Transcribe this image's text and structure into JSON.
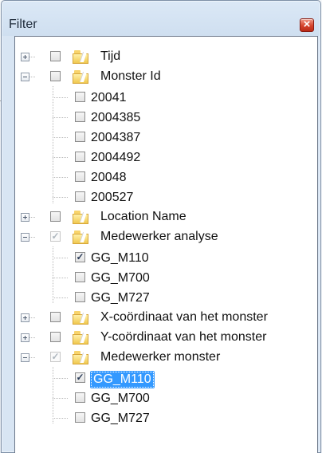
{
  "window": {
    "title": "Filter",
    "close_icon": "close-icon"
  },
  "tree": {
    "nodes": [
      {
        "label": "Tijd",
        "expanded": false,
        "checked": false
      },
      {
        "label": "Monster Id",
        "expanded": true,
        "checked": false,
        "children": [
          {
            "label": "20041",
            "checked": false
          },
          {
            "label": "2004385",
            "checked": false
          },
          {
            "label": "2004387",
            "checked": false
          },
          {
            "label": "2004492",
            "checked": false
          },
          {
            "label": "20048",
            "checked": false
          },
          {
            "label": "200527",
            "checked": false
          }
        ]
      },
      {
        "label": "Location Name",
        "expanded": false,
        "checked": false
      },
      {
        "label": "Medewerker analyse",
        "expanded": true,
        "checked": "partial",
        "children": [
          {
            "label": "GG_M110",
            "checked": true
          },
          {
            "label": "GG_M700",
            "checked": false
          },
          {
            "label": "GG_M727",
            "checked": false
          }
        ]
      },
      {
        "label": "X-coördinaat van het monster",
        "expanded": false,
        "checked": false
      },
      {
        "label": "Y-coördinaat van het monster",
        "expanded": false,
        "checked": false
      },
      {
        "label": "Medewerker monster",
        "expanded": true,
        "checked": "partial",
        "children": [
          {
            "label": "GG_M110",
            "checked": true,
            "selected": true
          },
          {
            "label": "GG_M700",
            "checked": false
          },
          {
            "label": "GG_M727",
            "checked": false
          }
        ]
      }
    ]
  },
  "colors": {
    "selection": "#3399ff",
    "close_button": "#d5432c",
    "window_border": "#7d8fa6"
  }
}
